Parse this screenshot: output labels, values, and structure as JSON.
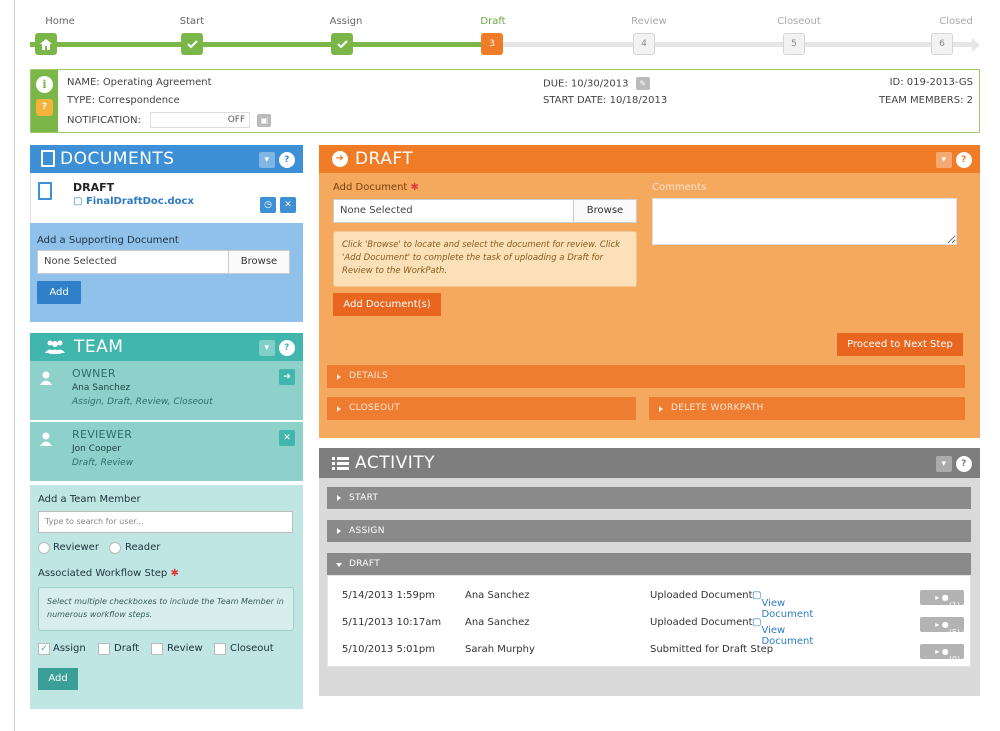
{
  "steps": [
    {
      "label": "Home",
      "marker": "home-icon",
      "state": "done"
    },
    {
      "label": "Start",
      "marker": "check-icon",
      "state": "done"
    },
    {
      "label": "Assign",
      "marker": "check-icon",
      "state": "done"
    },
    {
      "label": "Draft",
      "marker": "3",
      "state": "current"
    },
    {
      "label": "Review",
      "marker": "4",
      "state": "todo"
    },
    {
      "label": "Closeout",
      "marker": "5",
      "state": "todo"
    },
    {
      "label": "Closed",
      "marker": "6",
      "state": "todo"
    }
  ],
  "info": {
    "name": "NAME: Operating Agreement",
    "type": "TYPE: Correspondence",
    "notification_label": "NOTIFICATION:",
    "notification_value": "OFF",
    "due": "DUE: 10/30/2013",
    "start_date": "START DATE: 10/18/2013",
    "id": "ID: 019-2013-GS",
    "team_members": "TEAM MEMBERS: 2"
  },
  "documents": {
    "title": "DOCUMENTS",
    "current_label": "DRAFT",
    "current_file": "FinalDraftDoc.docx",
    "add_label": "Add a Supporting Document",
    "file_value": "None Selected",
    "browse": "Browse",
    "add_button": "Add"
  },
  "team": {
    "title": "TEAM",
    "members": [
      {
        "role": "OWNER",
        "name": "Ana Sanchez",
        "steps": "Assign, Draft, Review, Closeout"
      },
      {
        "role": "REVIEWER",
        "name": "Jon Cooper",
        "steps": "Draft, Review"
      }
    ],
    "add_label": "Add a Team Member",
    "search_placeholder": "Type to search for user...",
    "radio_reviewer": "Reviewer",
    "radio_reader": "Reader",
    "workflow_label": "Associated Workflow Step",
    "hint": "Select multiple checkboxes to include the Team Member in numerous workflow steps.",
    "checkboxes": [
      {
        "label": "Assign",
        "checked": true
      },
      {
        "label": "Draft",
        "checked": false
      },
      {
        "label": "Review",
        "checked": false
      },
      {
        "label": "Closeout",
        "checked": false
      }
    ],
    "add_button": "Add"
  },
  "draft": {
    "title": "DRAFT",
    "add_doc_label": "Add Document",
    "file_value": "None Selected",
    "browse": "Browse",
    "comments_label": "Comments",
    "hint": "Click 'Browse' to locate and select the document for review. Click 'Add Document' to complete the task of uploading a Draft for Review to the WorkPath.",
    "add_docs_button": "Add Document(s)",
    "proceed_button": "Proceed to Next Step",
    "details": "DETAILS",
    "closeout": "CLOSEOUT",
    "delete": "DELETE WORKPATH"
  },
  "activity": {
    "title": "ACTIVITY",
    "sections": [
      "START",
      "ASSIGN",
      "DRAFT"
    ],
    "rows": [
      {
        "date": "5/14/2013 1:59pm",
        "user": "Ana Sanchez",
        "action": "Uploaded Document",
        "link": "View Document",
        "comments": "(1)"
      },
      {
        "date": "5/11/2013 10:17am",
        "user": "Ana Sanchez",
        "action": "Uploaded Document",
        "link": "View Document",
        "comments": "(5)"
      },
      {
        "date": "5/10/2013 5:01pm",
        "user": "Sarah Murphy",
        "action": "Submitted for Draft Step",
        "link": "",
        "comments": "(0)"
      }
    ]
  },
  "colors": {
    "green": "#7ab648",
    "blue": "#3d8fd6",
    "teal": "#40b6ad",
    "orange": "#f07c28",
    "gray": "#7e7e7e"
  }
}
